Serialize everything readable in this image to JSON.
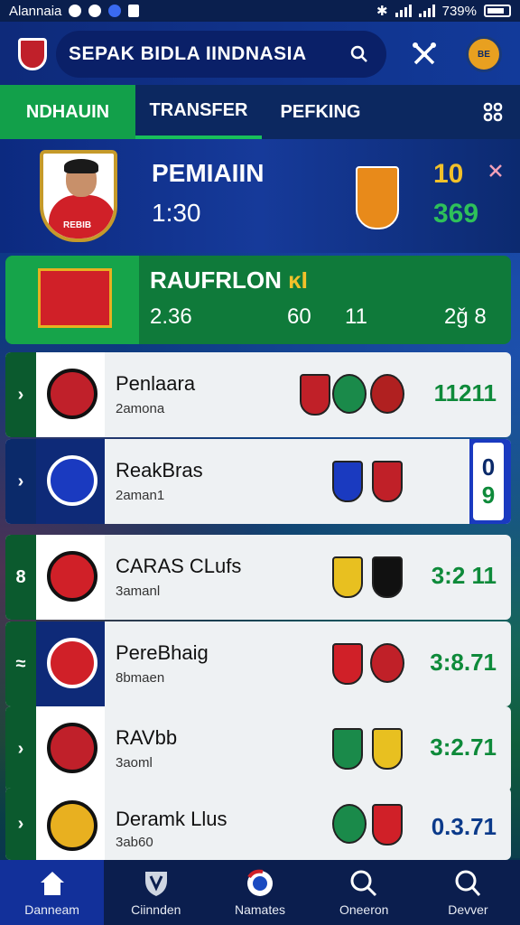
{
  "status_bar": {
    "carrier": "Alannaia",
    "battery": "739%"
  },
  "app_bar": {
    "title": "SEPAK BIDLA IINDNASIA",
    "profile_badge": "BE"
  },
  "tabs": [
    {
      "label": "NDHAUIN",
      "active": true
    },
    {
      "label": "TRANSFER",
      "active": false
    },
    {
      "label": "PEFKING",
      "active": false
    }
  ],
  "featured": {
    "label": "PEMIAIIN",
    "time": "1:30",
    "shirt_text": "REBIB",
    "stat_top": "10",
    "stat_bottom": "369",
    "colors": {
      "top": "#f2c12a",
      "bottom": "#2ec05a"
    }
  },
  "banner": {
    "title": "RAUFRLON",
    "title_accent": "ĸI",
    "stats": [
      "2.36",
      "60",
      "11",
      "2ǧ 8"
    ]
  },
  "clubs": [
    {
      "name": "Penlaara",
      "sub": "2amona",
      "score": "11211",
      "crest_color": "#c0202a",
      "arrow": "›"
    },
    {
      "name": "ReakBras",
      "sub": "2aman1",
      "score_top": "0",
      "score_bottom": "9",
      "crest_color": "#1a3ac0",
      "arrow": "›"
    },
    {
      "name": "CARAS CLufs",
      "sub": "3amanl",
      "score": "3:2 11",
      "crest_color": "#d02028",
      "arrow": "8"
    },
    {
      "name": "PereBhaig",
      "sub": "8bmaen",
      "score": "3:8.71",
      "crest_color": "#d02028",
      "arrow": "≈"
    },
    {
      "name": "RAVbb",
      "sub": "3aoml",
      "score": "3:2.71",
      "crest_color": "#c0202a",
      "arrow": "›"
    },
    {
      "name": "Deramk Llus",
      "sub": "3ab60",
      "score": "0.3.71",
      "crest_color": "#e8b020",
      "arrow": "›"
    }
  ],
  "bottom_nav": [
    {
      "label": "Danneam",
      "icon": "home-icon",
      "active": true
    },
    {
      "label": "Ciinnden",
      "icon": "shield-icon",
      "active": false
    },
    {
      "label": "Namates",
      "icon": "ball-icon",
      "active": false
    },
    {
      "label": "Oneeron",
      "icon": "search-icon",
      "active": false
    },
    {
      "label": "Devver",
      "icon": "search-icon",
      "active": false
    }
  ]
}
